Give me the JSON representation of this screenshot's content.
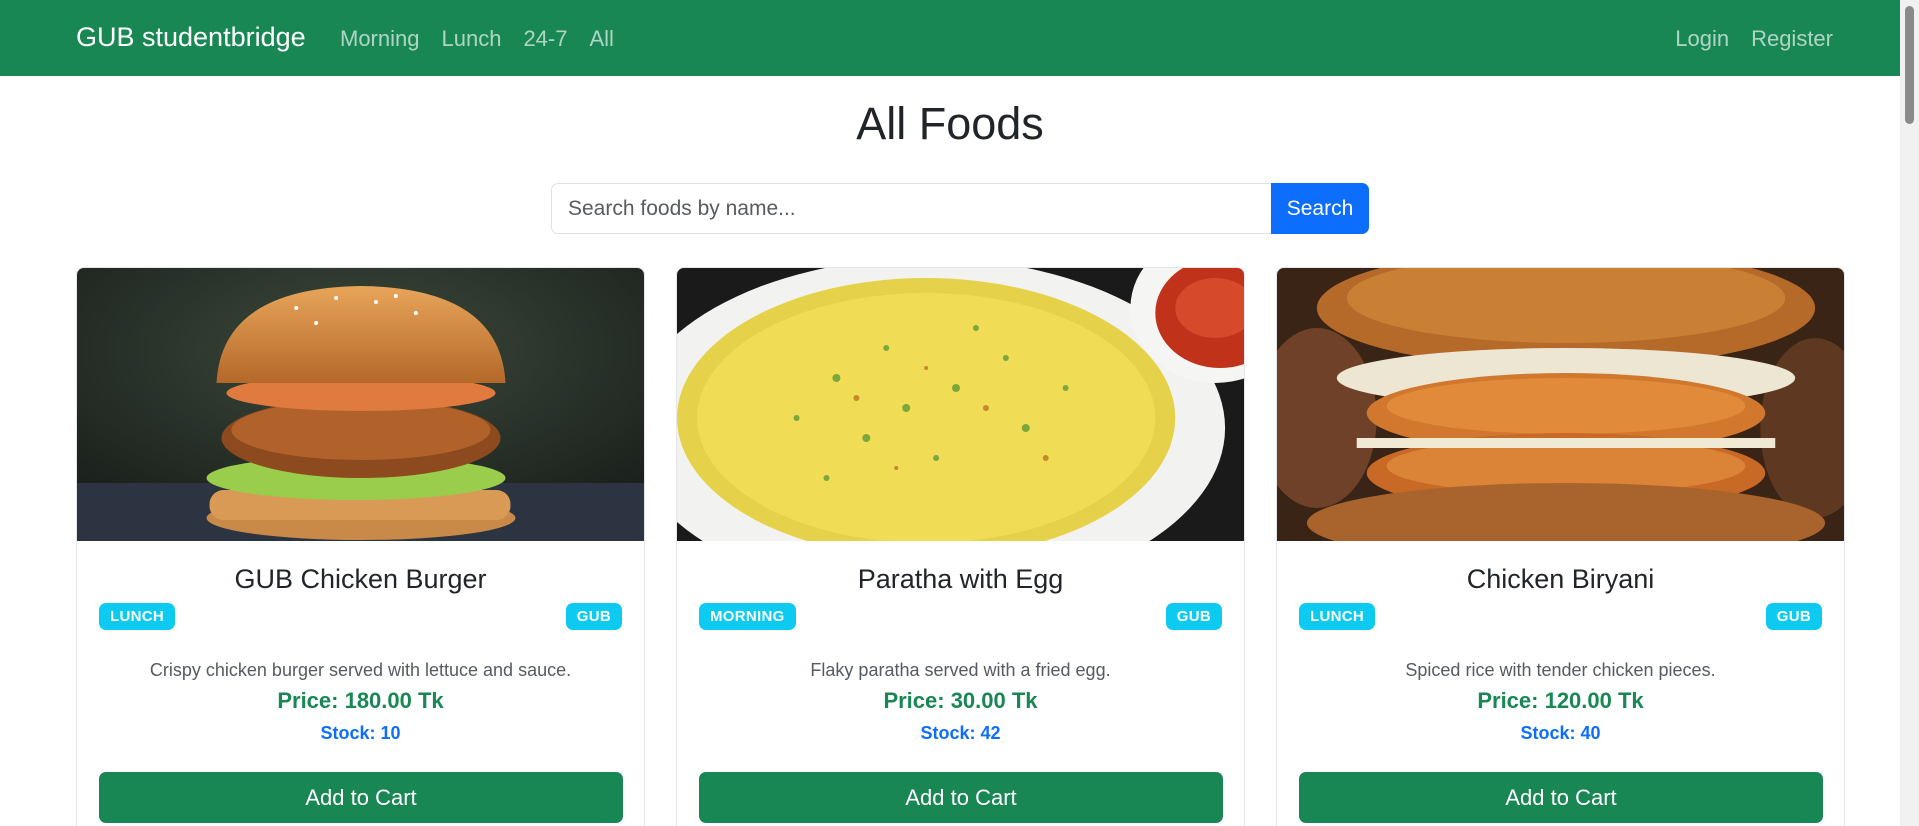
{
  "navbar": {
    "brand": "GUB studentbridge",
    "links": [
      {
        "label": "Morning"
      },
      {
        "label": "Lunch"
      },
      {
        "label": "24-7"
      },
      {
        "label": "All"
      }
    ],
    "login_label": "Login",
    "register_label": "Register",
    "background_color": "#198754"
  },
  "page": {
    "title": "All Foods"
  },
  "search": {
    "value": "",
    "placeholder": "Search foods by name...",
    "button_label": "Search"
  },
  "foods": [
    {
      "name": "GUB Chicken Burger",
      "category": "LUNCH",
      "tag": "GUB",
      "description": "Crispy chicken burger served with lettuce and sauce.",
      "price": "Price: 180.00 Tk",
      "stock": "Stock: 10",
      "button_label": "Add to Cart",
      "image_icon": "burger-photo"
    },
    {
      "name": "Paratha with Egg",
      "category": "MORNING",
      "tag": "GUB",
      "description": "Flaky paratha served with a fried egg.",
      "price": "Price: 30.00 Tk",
      "stock": "Stock: 42",
      "button_label": "Add to Cart",
      "image_icon": "paratha-photo"
    },
    {
      "name": "Chicken Biryani",
      "category": "LUNCH",
      "tag": "GUB",
      "description": "Spiced rice with tender chicken pieces.",
      "price": "Price: 120.00 Tk",
      "stock": "Stock: 40",
      "button_label": "Add to Cart",
      "image_icon": "chicken-sandwich-photo"
    }
  ],
  "colors": {
    "badge": "#0dcaf0",
    "price": "#198754",
    "stock": "#0d6efd",
    "search_button": "#0d6efd"
  }
}
